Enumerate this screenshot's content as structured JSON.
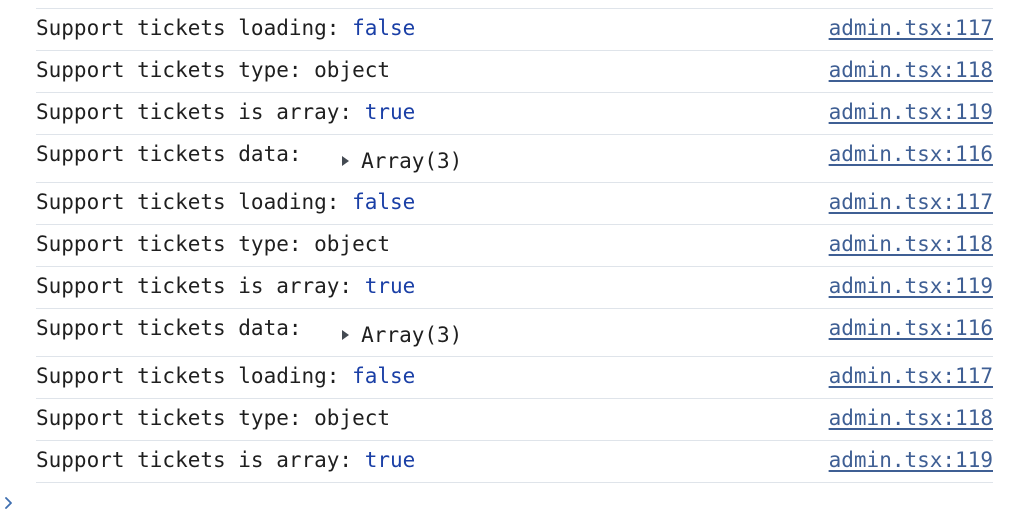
{
  "rows": [
    {
      "prefix": "Support tickets loading: ",
      "value": "false",
      "value_kind": "bool",
      "source": "admin.tsx:117"
    },
    {
      "prefix": "Support tickets type: ",
      "value": "object",
      "value_kind": "plain",
      "source": "admin.tsx:118"
    },
    {
      "prefix": "Support tickets is array: ",
      "value": "true",
      "value_kind": "bool",
      "source": "admin.tsx:119"
    },
    {
      "prefix": "Support tickets data: ",
      "value": "Array(3)",
      "value_kind": "expandable",
      "source": "admin.tsx:116"
    },
    {
      "prefix": "Support tickets loading: ",
      "value": "false",
      "value_kind": "bool",
      "source": "admin.tsx:117"
    },
    {
      "prefix": "Support tickets type: ",
      "value": "object",
      "value_kind": "plain",
      "source": "admin.tsx:118"
    },
    {
      "prefix": "Support tickets is array: ",
      "value": "true",
      "value_kind": "bool",
      "source": "admin.tsx:119"
    },
    {
      "prefix": "Support tickets data: ",
      "value": "Array(3)",
      "value_kind": "expandable",
      "source": "admin.tsx:116"
    },
    {
      "prefix": "Support tickets loading: ",
      "value": "false",
      "value_kind": "bool",
      "source": "admin.tsx:117"
    },
    {
      "prefix": "Support tickets type: ",
      "value": "object",
      "value_kind": "plain",
      "source": "admin.tsx:118"
    },
    {
      "prefix": "Support tickets is array: ",
      "value": "true",
      "value_kind": "bool",
      "source": "admin.tsx:119"
    }
  ],
  "colors": {
    "bool_value": "#1a3fa6",
    "source_link": "#3f5f94",
    "divider": "#dfe4ea",
    "text": "#1f1f1f"
  },
  "icons": {
    "expander": "triangle-right-icon",
    "prompt": "chevron-right-icon"
  }
}
